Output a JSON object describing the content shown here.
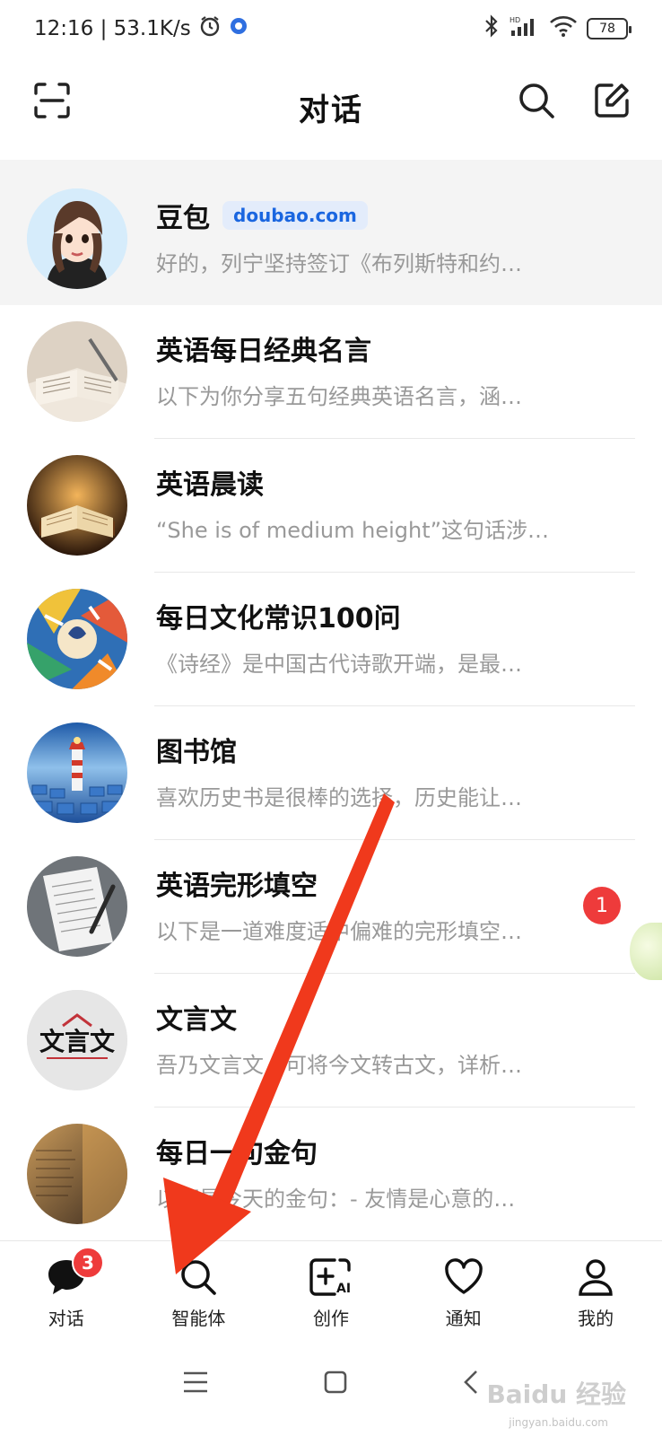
{
  "status_bar": {
    "time_speed": "12:16 | 53.1K/s",
    "battery": "78"
  },
  "header": {
    "title": "对话",
    "icons": [
      "scan-icon",
      "search-icon",
      "edit-icon"
    ]
  },
  "chats": [
    {
      "name": "豆包",
      "tag": "doubao.com",
      "preview": "好的，列宁坚持签订《布列斯特和约…",
      "pinned": true,
      "avatar_color": "#d6ecfb"
    },
    {
      "name": "英语每日经典名言",
      "preview": "以下为你分享五句经典英语名言，涵…",
      "avatar_color": "#d8cdbf"
    },
    {
      "name": "英语晨读",
      "preview": "“She is of medium height”这句话涉…",
      "avatar_color": "#5a3a1a"
    },
    {
      "name": "每日文化常识100问",
      "preview": "《诗经》是中国古代诗歌开端，是最…",
      "avatar_color": "#3b7fbf"
    },
    {
      "name": "图书馆",
      "preview": "喜欢历史书是很棒的选择，历史能让…",
      "avatar_color": "#2a70c0"
    },
    {
      "name": "英语完形填空",
      "preview": "以下是一道难度适中偏难的完形填空…",
      "avatar_color": "#9aa0a6",
      "unread": "1"
    },
    {
      "name": "文言文",
      "preview": "吾乃文言文，可将今文转古文，详析…",
      "avatar_color": "#e5e5e5",
      "avatar_text": "文言文"
    },
    {
      "name": "每日一句金句",
      "preview": "以下是今天的金句：- 友情是心意的…",
      "avatar_color": "#8a6a4a"
    }
  ],
  "bottom_nav": [
    {
      "label": "对话",
      "icon": "chat-icon",
      "badge": "3"
    },
    {
      "label": "智能体",
      "icon": "search-icon"
    },
    {
      "label": "创作",
      "icon": "create-ai-icon"
    },
    {
      "label": "通知",
      "icon": "heart-icon"
    },
    {
      "label": "我的",
      "icon": "profile-icon"
    }
  ],
  "system_nav": [
    "menu-icon",
    "home-icon",
    "back-icon"
  ],
  "watermark": {
    "main": "Baidu 经验",
    "sub": "jingyan.baidu.com"
  },
  "colors": {
    "accent_red": "#ee3b3b",
    "arrow_red": "#f0391c",
    "tag_blue": "#1a66e0"
  }
}
